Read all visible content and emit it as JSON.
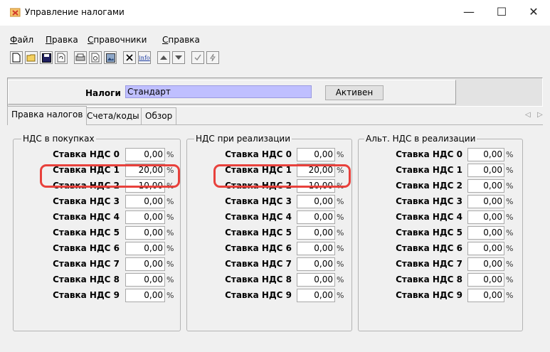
{
  "window": {
    "title": "Управление налогами",
    "controls": {
      "minimize": "—",
      "maximize": "☐",
      "close": "✕"
    }
  },
  "menu": [
    "Файл",
    "Правка",
    "Справочники",
    "Справка"
  ],
  "toolbar": {
    "icons": [
      "new-doc-icon",
      "open-folder-icon",
      "save-icon",
      "refresh-icon",
      "print-icon",
      "print-preview-icon",
      "image-icon",
      "delete-icon",
      "info-icon",
      "arrow-up-icon",
      "arrow-down-icon",
      "check-icon",
      "lightning-icon"
    ],
    "info_label": "info"
  },
  "header": {
    "label": "Налоги",
    "value": "Стандарт",
    "button": "Активен"
  },
  "tabs": [
    "Правка налогов",
    "Счета/коды",
    "Обзор"
  ],
  "groups": [
    {
      "title": "НДС в покупках",
      "rows": [
        {
          "label": "Ставка НДС 0",
          "value": "0,00"
        },
        {
          "label": "Ставка НДС 1",
          "value": "20,00"
        },
        {
          "label": "Ставка НДС 2",
          "value": "10,00"
        },
        {
          "label": "Ставка НДС 3",
          "value": "0,00"
        },
        {
          "label": "Ставка НДС 4",
          "value": "0,00"
        },
        {
          "label": "Ставка НДС 5",
          "value": "0,00"
        },
        {
          "label": "Ставка НДС 6",
          "value": "0,00"
        },
        {
          "label": "Ставка НДС 7",
          "value": "0,00"
        },
        {
          "label": "Ставка НДС 8",
          "value": "0,00"
        },
        {
          "label": "Ставка НДС 9",
          "value": "0,00"
        }
      ]
    },
    {
      "title": "НДС при реализации",
      "rows": [
        {
          "label": "Ставка НДС 0",
          "value": "0,00"
        },
        {
          "label": "Ставка НДС 1",
          "value": "20,00"
        },
        {
          "label": "Ставка НДС 2",
          "value": "10,00"
        },
        {
          "label": "Ставка НДС 3",
          "value": "0,00"
        },
        {
          "label": "Ставка НДС 4",
          "value": "0,00"
        },
        {
          "label": "Ставка НДС 5",
          "value": "0,00"
        },
        {
          "label": "Ставка НДС 6",
          "value": "0,00"
        },
        {
          "label": "Ставка НДС 7",
          "value": "0,00"
        },
        {
          "label": "Ставка НДС 8",
          "value": "0,00"
        },
        {
          "label": "Ставка НДС 9",
          "value": "0,00"
        }
      ]
    },
    {
      "title": "Альт. НДС в реализации",
      "rows": [
        {
          "label": "Ставка НДС 0",
          "value": "0,00"
        },
        {
          "label": "Ставка НДС 1",
          "value": "0,00"
        },
        {
          "label": "Ставка НДС 2",
          "value": "0,00"
        },
        {
          "label": "Ставка НДС 3",
          "value": "0,00"
        },
        {
          "label": "Ставка НДС 4",
          "value": "0,00"
        },
        {
          "label": "Ставка НДС 5",
          "value": "0,00"
        },
        {
          "label": "Ставка НДС 6",
          "value": "0,00"
        },
        {
          "label": "Ставка НДС 7",
          "value": "0,00"
        },
        {
          "label": "Ставка НДС 8",
          "value": "0,00"
        },
        {
          "label": "Ставка НДС 9",
          "value": "0,00"
        }
      ]
    }
  ],
  "percent_sign": "%",
  "colors": {
    "highlight": "#e8413c",
    "field_highlight": "#bfbfff"
  }
}
